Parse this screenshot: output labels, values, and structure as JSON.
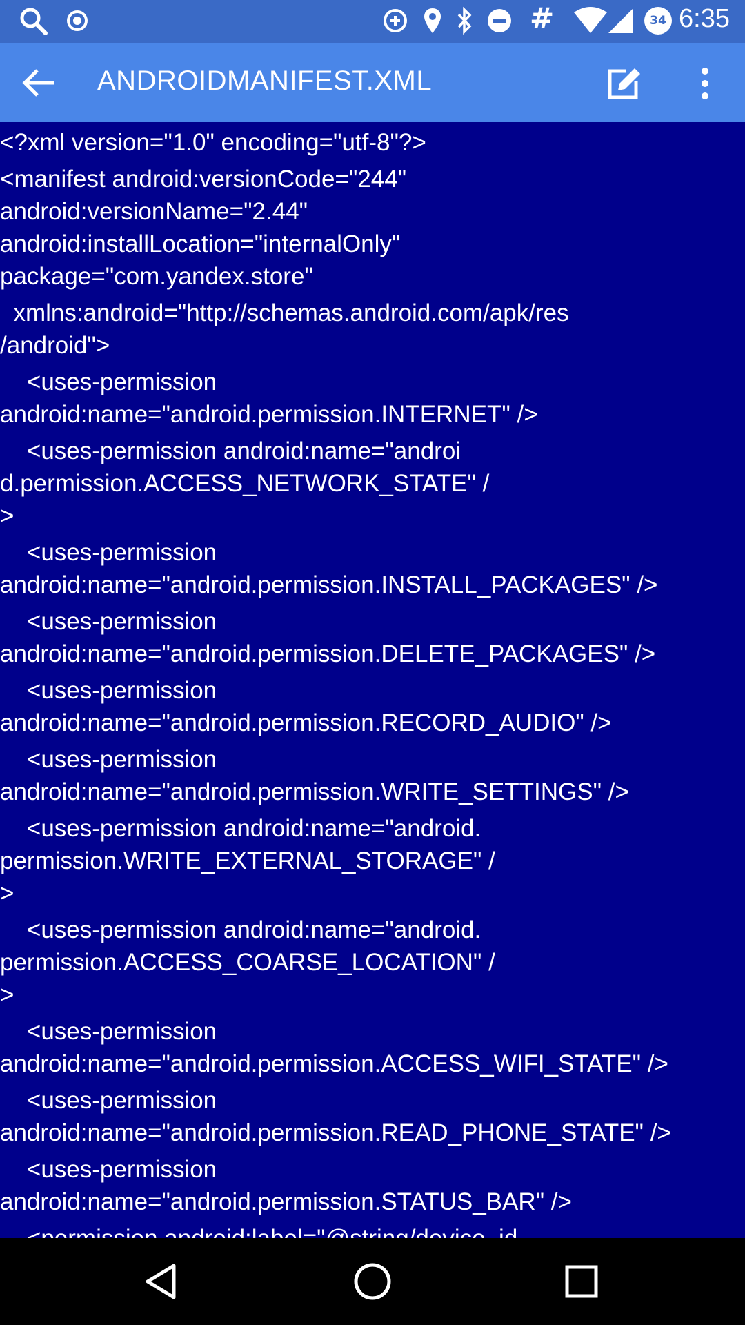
{
  "status_bar": {
    "time": "6:35",
    "battery_level": "34",
    "icons": [
      "search-icon",
      "record-icon",
      "data-saver-icon",
      "location-icon",
      "bluetooth-icon",
      "dnd-icon",
      "hash-icon",
      "wifi-icon",
      "signal-icon",
      "battery-icon"
    ]
  },
  "app_bar": {
    "title": "AndroidManifest.xml",
    "back_icon": "arrow-back-icon",
    "edit_icon": "edit-icon",
    "more_icon": "more-vert-icon"
  },
  "code": {
    "blocks": [
      [
        "<?xml version=\"1.0\" encoding=\"utf-8\"?>"
      ],
      [
        "<manifest android:versionCode=\"244\"",
        "android:versionName=\"2.44\"",
        "android:installLocation=\"internalOnly\"",
        "package=\"com.yandex.store\""
      ],
      [
        "  xmlns:android=\"http://schemas.android.com/apk/res",
        "/android\">"
      ],
      [
        "    <uses-permission",
        "android:name=\"android.permission.INTERNET\" />"
      ],
      [
        "    <uses-permission android:name=\"androi",
        "d.permission.ACCESS_NETWORK_STATE\" /",
        ">"
      ],
      [
        "    <uses-permission",
        "android:name=\"android.permission.INSTALL_PACKAGES\" />"
      ],
      [
        "    <uses-permission",
        "android:name=\"android.permission.DELETE_PACKAGES\" />"
      ],
      [
        "    <uses-permission",
        "android:name=\"android.permission.RECORD_AUDIO\" />"
      ],
      [
        "    <uses-permission",
        "android:name=\"android.permission.WRITE_SETTINGS\" />"
      ],
      [
        "    <uses-permission android:name=\"android.",
        "permission.WRITE_EXTERNAL_STORAGE\" /",
        ">"
      ],
      [
        "    <uses-permission android:name=\"android.",
        "permission.ACCESS_COARSE_LOCATION\" /",
        ">"
      ],
      [
        "    <uses-permission",
        "android:name=\"android.permission.ACCESS_WIFI_STATE\" />"
      ],
      [
        "    <uses-permission",
        "android:name=\"android.permission.READ_PHONE_STATE\" />"
      ],
      [
        "    <uses-permission",
        "android:name=\"android.permission.STATUS_BAR\" />"
      ],
      [
        "    <permission android:label=\"@string/device_id"
      ]
    ]
  },
  "nav_bar": {
    "back_icon": "nav-back-icon",
    "home_icon": "nav-home-icon",
    "recents_icon": "nav-recents-icon"
  },
  "colors": {
    "status_bar": "#3a6ac6",
    "app_bar": "#4a86e8",
    "content_bg": "#00008b",
    "text": "#ffffff",
    "nav_bar": "#000000"
  }
}
